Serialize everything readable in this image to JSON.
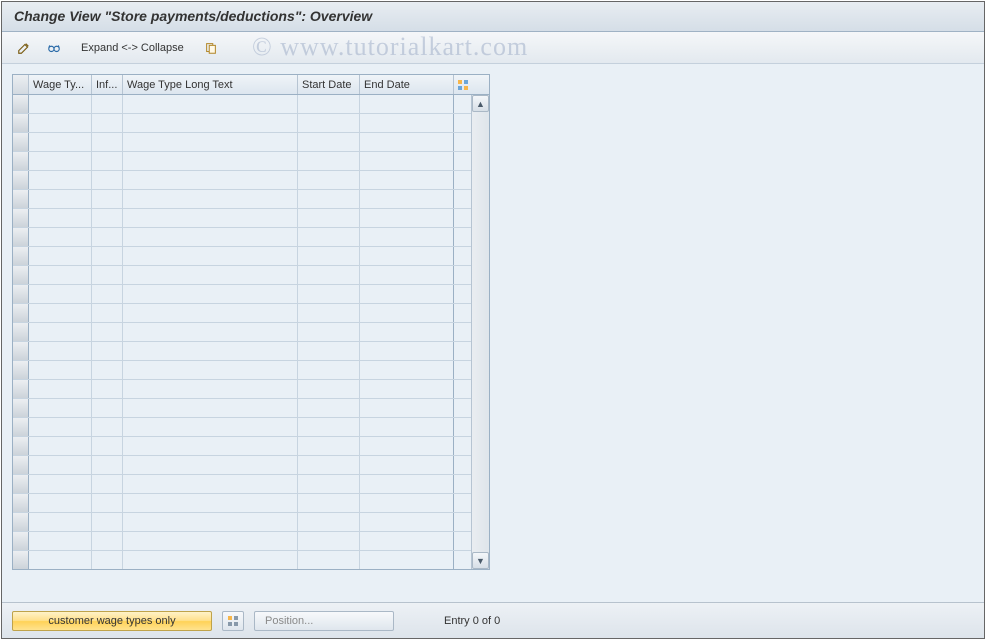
{
  "title": "Change View \"Store payments/deductions\": Overview",
  "watermark": "© www.tutorialkart.com",
  "toolbar": {
    "display_change_tooltip": "Display/Change",
    "other_view_tooltip": "Other View",
    "expand_collapse_label": "Expand <-> Collapse",
    "copy_tooltip": "Copy"
  },
  "grid": {
    "columns": {
      "wage_type": "Wage Ty...",
      "infotype": "Inf...",
      "wage_type_long_text": "Wage Type Long Text",
      "start_date": "Start Date",
      "end_date": "End Date"
    },
    "config_tooltip": "Configuration",
    "row_count": 25,
    "rows": []
  },
  "scrollbar": {
    "up_tooltip": "Scroll Up",
    "down_tooltip": "Scroll Down"
  },
  "footer": {
    "customer_wage_types_label": "customer wage types only",
    "select_tooltip": "Select",
    "position_label": "Position...",
    "entry_text": "Entry 0 of 0"
  }
}
